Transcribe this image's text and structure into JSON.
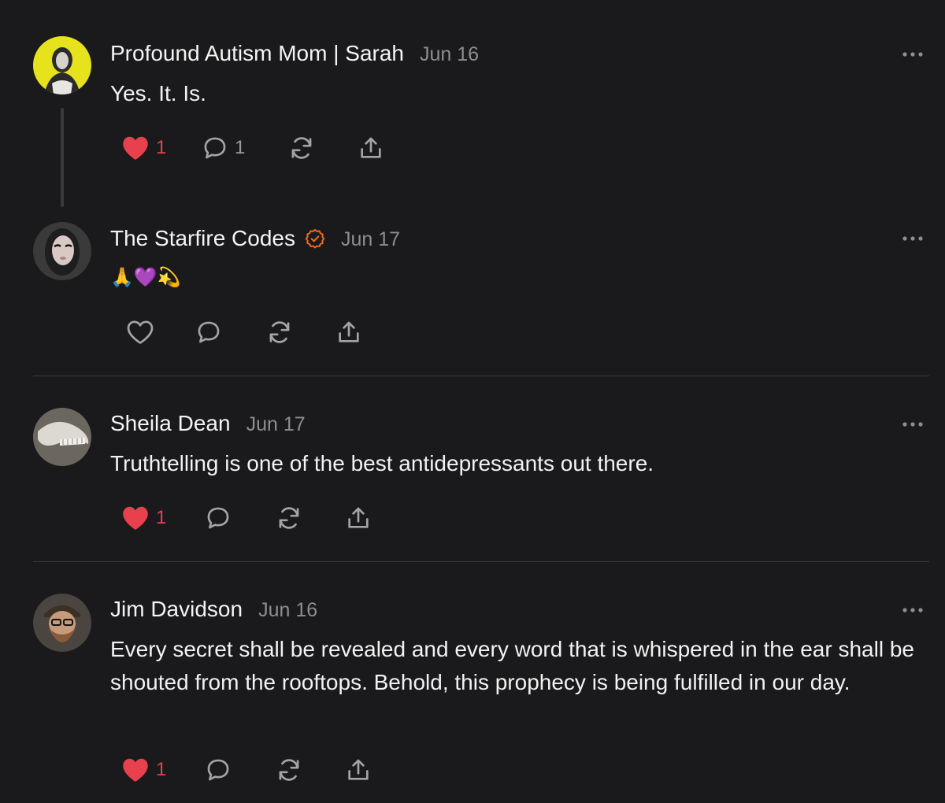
{
  "comments": [
    {
      "author": "Profound Autism Mom | Sarah",
      "date": "Jun 16",
      "text": "Yes. It. Is.",
      "like_count": "1",
      "reply_count": "1",
      "liked": true
    },
    {
      "author": "The Starfire Codes",
      "date": "Jun 17",
      "text": "🙏💜💫",
      "verified": true,
      "liked": false
    },
    {
      "author": "Sheila Dean",
      "date": "Jun 17",
      "text": "Truthtelling is one of the best antidepressants out there.",
      "like_count": "1",
      "liked": true
    },
    {
      "author": "Jim Davidson",
      "date": "Jun 16",
      "text": "Every secret shall be revealed and every word that is whispered in the ear shall be shouted from the rooftops. Behold, this prophecy is being fulfilled in our day.",
      "like_count": "1",
      "liked": true
    }
  ],
  "colors": {
    "background": "#1a1a1c",
    "like_red": "#e8404c",
    "verified_orange": "#f26a21",
    "muted": "#8d8d92"
  },
  "icons": [
    "heart-icon",
    "comment-icon",
    "restack-icon",
    "share-icon",
    "more-icon",
    "verified-icon"
  ]
}
